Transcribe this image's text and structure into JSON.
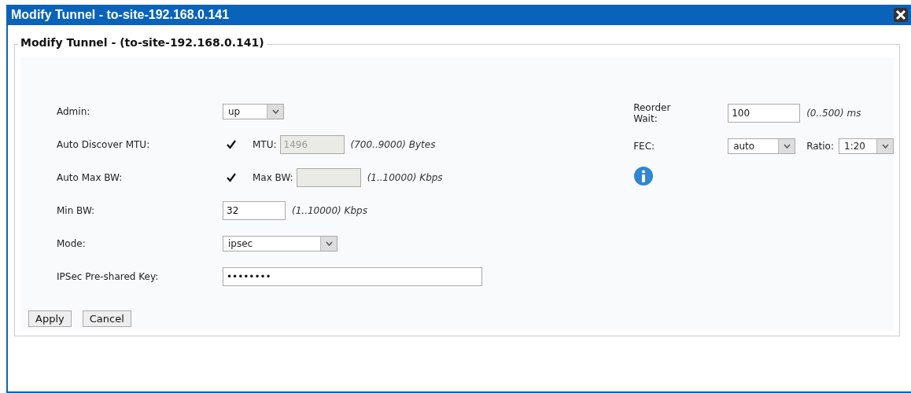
{
  "window": {
    "title": "Modify Tunnel - to-site-192.168.0.141"
  },
  "form": {
    "legend": "Modify Tunnel - (to-site-192.168.0.141)",
    "left_fields": [
      {
        "kind": "select",
        "label": "Admin:",
        "value": "up"
      },
      {
        "kind": "check",
        "label": "Auto Discover MTU:",
        "checked": true,
        "sub_label": "MTU:",
        "sub_value": "1496",
        "sub_disabled": true,
        "hint": "(700..9000) Bytes"
      },
      {
        "kind": "check",
        "label": "Auto Max BW:",
        "checked": true,
        "sub_label": "Max BW:",
        "sub_disabled": true,
        "hint": "(1..10000) Kbps"
      },
      {
        "kind": "input",
        "label": "Min BW:",
        "value": "32",
        "hint": "(1..10000) Kbps"
      },
      {
        "kind": "select",
        "label": "Mode:",
        "value": "ipsec"
      },
      {
        "kind": "input",
        "label": "IPSec Pre-shared Key:",
        "value": "••••••••"
      }
    ],
    "reorder_wait": {
      "label": "Reorder Wait:",
      "value": "100",
      "hint": "(0..500) ms"
    },
    "fec": {
      "label": "FEC:",
      "value": "auto",
      "ratio_label": "Ratio:",
      "ratio_value": "1:20"
    },
    "buttons": [
      "Apply",
      "Cancel"
    ]
  }
}
